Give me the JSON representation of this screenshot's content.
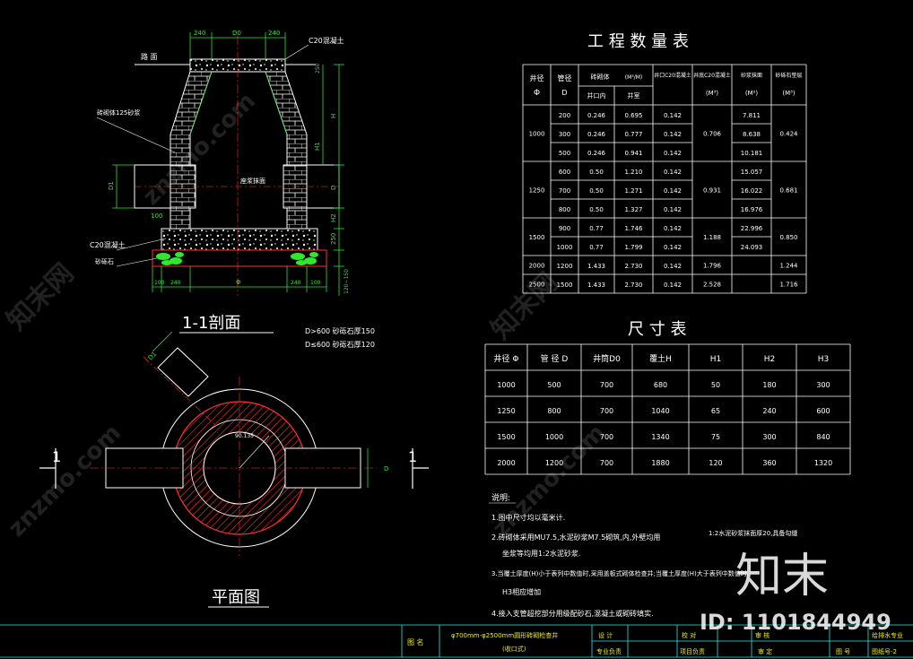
{
  "section": {
    "title": "1-1剖面",
    "top_dims": [
      "240",
      "D0",
      "240"
    ],
    "label_road": "路 面",
    "label_c20_top": "C20混凝土",
    "label_brick": "砖砌体125砂浆",
    "label_mortar": "座浆抹面",
    "label_c20_base": "C20混凝土",
    "label_gravel": "砂砾石",
    "left_dims": [
      "D1",
      "100"
    ],
    "right_dims": [
      "H",
      "H1",
      "D",
      "H2",
      "250"
    ],
    "bottom_dims": [
      "100",
      "240",
      "Φ",
      "240",
      "100"
    ],
    "right_bottom_dim": "120~150",
    "right_top_dim": "250",
    "note_1": "D>600  砂砾石厚150",
    "note_2": "D≤600  砂砾石厚120"
  },
  "plan": {
    "title": "平面图",
    "label_d1": "D1",
    "label_center": "90.135",
    "label_d": "D",
    "cut_label_left": "1",
    "cut_label_right": "1"
  },
  "qty_table": {
    "title": "工 程 数 量 表",
    "header_well": "井径",
    "header_well_sym": "Φ",
    "header_pipe": "管径",
    "header_pipe_sym": "D",
    "header_brick": "砖砌体",
    "header_brick_unit": "(M³/M)",
    "header_brick_sub1": "井口内",
    "header_brick_sub2": "井室",
    "header_c20": "井口C20混凝土",
    "header_base": "井底C20混凝土",
    "header_base_unit": "(M³)",
    "header_plaster": "砂浆抹面",
    "header_plaster_unit": "(M²)",
    "header_gravel": "砂砾石垫层",
    "header_gravel_unit": "(M³)",
    "rows": [
      [
        "1000",
        "200",
        "0.246",
        "0.695",
        "0.142",
        "0.706",
        "7.811",
        "0.424"
      ],
      [
        "",
        "300",
        "0.246",
        "0.777",
        "0.142",
        "",
        "8.638",
        ""
      ],
      [
        "",
        "500",
        "0.246",
        "0.941",
        "0.142",
        "",
        "10.181",
        ""
      ],
      [
        "1250",
        "600",
        "0.50",
        "1.210",
        "0.142",
        "0.931",
        "15.057",
        "0.681"
      ],
      [
        "",
        "700",
        "0.50",
        "1.271",
        "0.142",
        "",
        "16.022",
        ""
      ],
      [
        "",
        "800",
        "0.50",
        "1.327",
        "0.142",
        "",
        "16.976",
        ""
      ],
      [
        "1500",
        "900",
        "0.77",
        "1.746",
        "0.142",
        "1.188",
        "22.996",
        "0.850"
      ],
      [
        "",
        "1000",
        "0.77",
        "1.799",
        "0.142",
        "",
        "24.093",
        ""
      ],
      [
        "2000",
        "1200",
        "1.433",
        "2.730",
        "0.142",
        "1.796",
        "",
        "1.244"
      ],
      [
        "2500",
        "1500",
        "1.433",
        "2.730",
        "0.142",
        "2.528",
        "",
        "1.716"
      ]
    ]
  },
  "size_table": {
    "title": "尺 寸 表",
    "headers": [
      "井径 Φ",
      "管 径 D",
      "井筒D0",
      "覆土H",
      "H1",
      "H2",
      "H3"
    ],
    "rows": [
      [
        "1000",
        "500",
        "700",
        "680",
        "50",
        "180",
        "300"
      ],
      [
        "1250",
        "800",
        "700",
        "1040",
        "65",
        "240",
        "600"
      ],
      [
        "1500",
        "1000",
        "700",
        "1340",
        "75",
        "300",
        "840"
      ],
      [
        "2000",
        "1200",
        "700",
        "1880",
        "120",
        "360",
        "1320"
      ]
    ]
  },
  "notes": {
    "title": "说明:",
    "items": [
      "1.图中尺寸均以毫米计.",
      "2.砖砌体采用MU7.5,水泥砂浆M7.5砌筑,内,外壁均用",
      "1:2水泥砂浆抹面厚20,具备勾缝",
      "坐浆等均用1:2水泥砂浆.",
      "3.当覆土厚度(H)小于表列中数值时,采用盖板式砌体检查井;当覆土厚度(H)大于表列中数值时,",
      "H3相应增加",
      "4.接入支管超挖部分用级配砂石,混凝土或砌砖填实."
    ]
  },
  "title_block": {
    "label_name": "图 名",
    "drawing_name_1": "φ700mm-φ2500mm圆形砖砌检查井",
    "drawing_name_2": "(收口式)",
    "cell_design": "设 计",
    "cell_check": "校 对",
    "cell_review": "审 核",
    "cell_major": "专业负责",
    "cell_project": "项目负责",
    "cell_approve": "审 定",
    "cell_drawing_no": "图 号",
    "cell_category": "给排水专业",
    "cell_sheet_no": "图纸号-2"
  },
  "watermark": {
    "brand": "知末",
    "id": "ID: 1101844949",
    "site": "znzmo.com",
    "site_cn": "知末网"
  },
  "colors": {
    "background": "#000000",
    "line": "#ffffff",
    "dimension": "#2ee82e",
    "hatch": "#ff3030",
    "text_yellow": "#f0f000",
    "text_cyan": "#2ee8e8"
  }
}
